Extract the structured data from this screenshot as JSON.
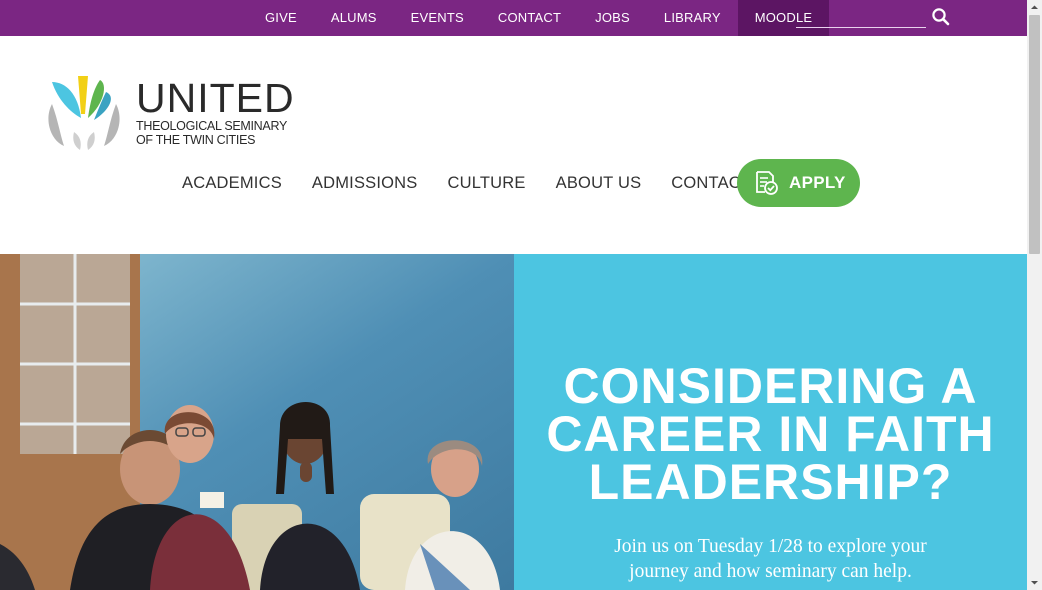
{
  "topbar": {
    "links": [
      {
        "label": "GIVE"
      },
      {
        "label": "ALUMS"
      },
      {
        "label": "EVENTS"
      },
      {
        "label": "CONTACT"
      },
      {
        "label": "JOBS"
      },
      {
        "label": "LIBRARY"
      },
      {
        "label": "MOODLE",
        "active": true
      }
    ],
    "search": {
      "value": "",
      "placeholder": "",
      "icon": "search-icon"
    },
    "color": "#7b2683",
    "active_color": "#5c1563"
  },
  "logo": {
    "word": "UNITED",
    "sub_line1": "THEOLOGICAL SEMINARY",
    "sub_line2": "OF THE TWIN CITIES",
    "colors": [
      "#4cc5e1",
      "#f2d016",
      "#5eb54e",
      "#9a9a9a"
    ]
  },
  "mainnav": {
    "items": [
      {
        "label": "ACADEMICS"
      },
      {
        "label": "ADMISSIONS"
      },
      {
        "label": "CULTURE"
      },
      {
        "label": "ABOUT US"
      },
      {
        "label": "CONTACT"
      }
    ],
    "apply": {
      "label": "APPLY",
      "icon": "application-check-icon",
      "color": "#5eb54e"
    }
  },
  "hero": {
    "title_line1": "CONSIDERING A",
    "title_line2": "CAREER IN FAITH",
    "title_line3": "LEADERSHIP?",
    "subtitle_line1": "Join us on Tuesday 1/28 to explore your",
    "subtitle_line2": "journey and how seminary can help.",
    "panel_color": "#4cc5e1",
    "photo": "group-of-people-laughing-photo"
  }
}
